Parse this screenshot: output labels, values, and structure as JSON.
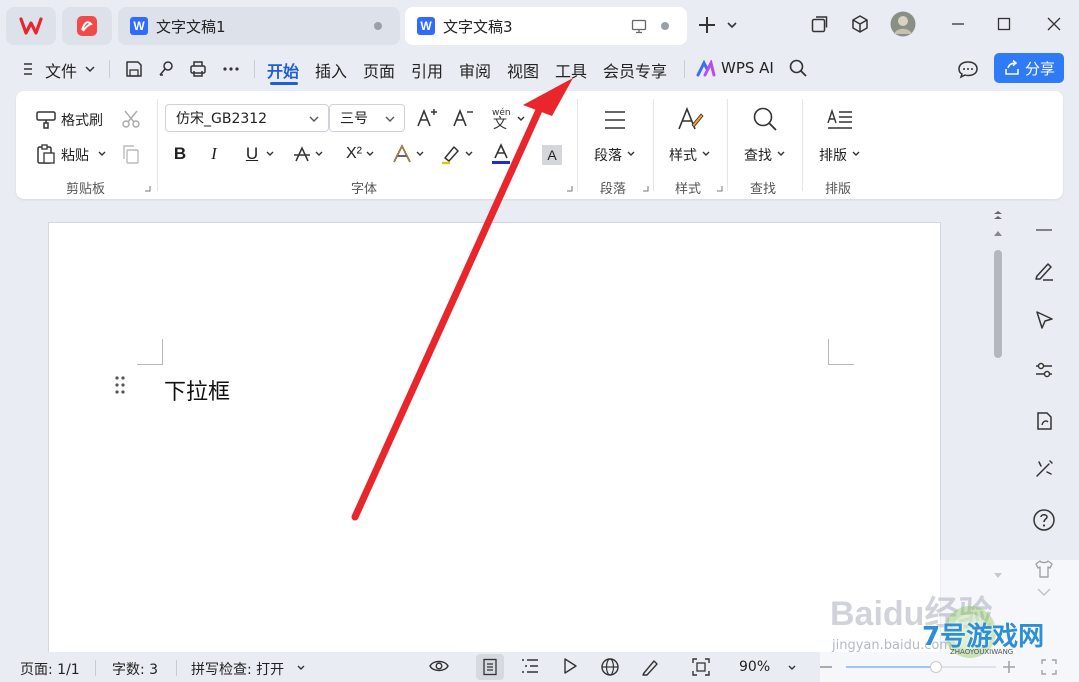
{
  "tabs": {
    "doc1": "文字文稿1",
    "doc3": "文字文稿3",
    "w_letter": "W"
  },
  "menu": {
    "file": "文件",
    "items": [
      "开始",
      "插入",
      "页面",
      "引用",
      "审阅",
      "视图",
      "工具",
      "会员专享"
    ],
    "wps_ai": "WPS AI",
    "share": "分享"
  },
  "ribbon": {
    "format_painter": "格式刷",
    "paste": "粘贴",
    "clipboard_label": "剪贴板",
    "font_name": "仿宋_GB2312",
    "font_size": "三号",
    "font_label": "字体",
    "paragraph": "段落",
    "paragraph_label": "段落",
    "styles": "样式",
    "styles_label": "样式",
    "find": "查找",
    "find_label": "查找",
    "layout": "排版",
    "layout_label": "排版",
    "bold": "B",
    "italic": "I",
    "underline": "U",
    "superscript": "X²",
    "phonetic": "wén",
    "highlight_letter": "A"
  },
  "document": {
    "body_text": "下拉框"
  },
  "status": {
    "page": "页面: 1/1",
    "word_count": "字数: 3",
    "spell_check": "拼写检查: 打开",
    "zoom": "90%",
    "zoom_fraction": 0.6
  },
  "watermark": {
    "baidu": "Baidu经验",
    "jingyan": "jingyan.baidu.com",
    "site": "7号游戏网",
    "site_sub": "ZHAOYOUXIWANG"
  },
  "colors": {
    "accent": "#1f5fd6",
    "share_button": "#2f7af5",
    "arrow": "#e8262b",
    "font_color_bar": "#1b2bd6"
  }
}
